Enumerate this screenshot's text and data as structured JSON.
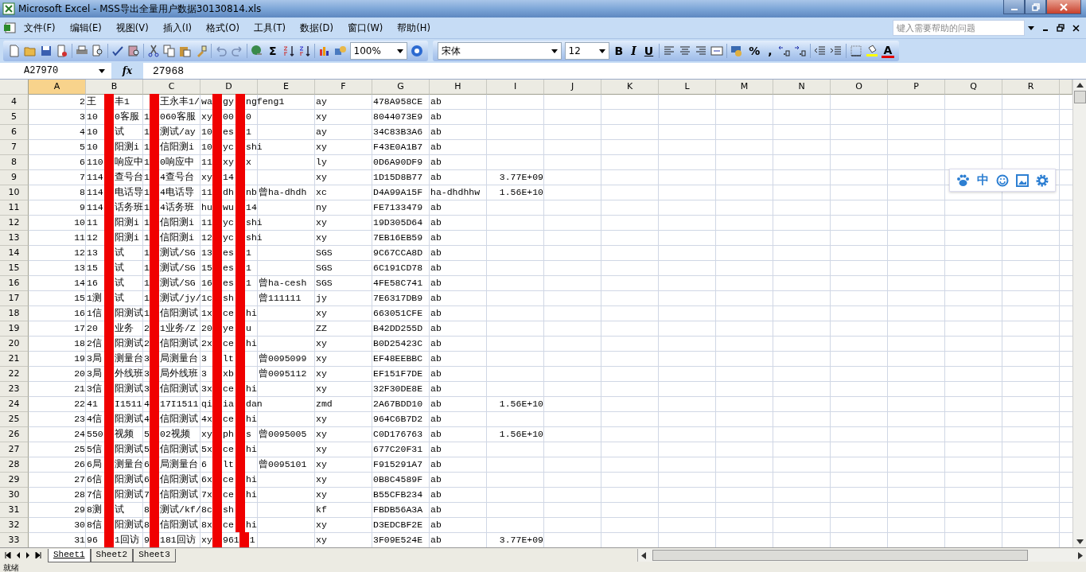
{
  "window": {
    "title": "Microsoft Excel - MSS导出全量用户数据30130814.xls"
  },
  "menu": [
    "文件(F)",
    "编辑(E)",
    "视图(V)",
    "插入(I)",
    "格式(O)",
    "工具(T)",
    "数据(D)",
    "窗口(W)",
    "帮助(H)"
  ],
  "help_search": {
    "placeholder": "键入需要帮助的问题"
  },
  "toolbar": {
    "sum": "Σ",
    "zoom": "100%",
    "font": "宋体",
    "size": "12",
    "format_buttons": [
      "B",
      "I",
      "U"
    ],
    "percent": "%",
    "comma": ",",
    "font_color": "A"
  },
  "formula_bar": {
    "name_box": "A27970",
    "fx": "fx",
    "value": "27968"
  },
  "columns": [
    {
      "label": "A",
      "selected": true
    },
    {
      "label": "B",
      "selected": false
    },
    {
      "label": "C",
      "selected": false
    },
    {
      "label": "D",
      "selected": false
    },
    {
      "label": "E",
      "selected": false
    },
    {
      "label": "F",
      "selected": false
    },
    {
      "label": "G",
      "selected": false
    },
    {
      "label": "H",
      "selected": false
    },
    {
      "label": "I",
      "selected": false
    },
    {
      "label": "J",
      "selected": false
    },
    {
      "label": "K",
      "selected": false
    },
    {
      "label": "L",
      "selected": false
    },
    {
      "label": "M",
      "selected": false
    },
    {
      "label": "N",
      "selected": false
    },
    {
      "label": "O",
      "selected": false
    },
    {
      "label": "P",
      "selected": false
    },
    {
      "label": "Q",
      "selected": false
    },
    {
      "label": "R",
      "selected": false
    }
  ],
  "rows": [
    {
      "num": "4",
      "a": "2",
      "b": {
        "pre": "王",
        "post": "丰1"
      },
      "c": {
        "post": "王永丰1/"
      },
      "d": {
        "pre": "wa",
        "mid": "gy",
        "post": "ngfeng1"
      },
      "f": "ay",
      "g": "478A958CE",
      "h": "ab"
    },
    {
      "num": "5",
      "a": "3",
      "b": {
        "pre": "10",
        "post": "0客服"
      },
      "c": {
        "pre": "1",
        "post": "060客服"
      },
      "d": {
        "pre": "xy",
        "mid": "00",
        "post": "0"
      },
      "f": "xy",
      "g": "8044073E9",
      "h": "ab"
    },
    {
      "num": "6",
      "a": "4",
      "b": {
        "pre": "10",
        "post": "试"
      },
      "c": {
        "pre": "1",
        "post": "测试/ay"
      },
      "d": {
        "pre": "10",
        "mid": "es",
        "post": "1"
      },
      "f": "ay",
      "g": "34C83B3A6",
      "h": "ab"
    },
    {
      "num": "7",
      "a": "5",
      "b": {
        "pre": "10",
        "post": "阳测i"
      },
      "c": {
        "pre": "1",
        "post": "信阳测i"
      },
      "d": {
        "pre": "10",
        "mid": "yc",
        "post": "shi"
      },
      "f": "xy",
      "g": "F43E0A1B7",
      "h": "ab"
    },
    {
      "num": "8",
      "a": "6",
      "b": {
        "pre": "110",
        "post": "响应中"
      },
      "c": {
        "pre": "1",
        "post": "0响应中"
      },
      "d": {
        "pre": "11",
        "mid": "xy",
        "post": "x"
      },
      "f": "ly",
      "g": "0D6A90DF9",
      "h": "ab"
    },
    {
      "num": "9",
      "a": "7",
      "b": {
        "pre": "114",
        "post": "查号台"
      },
      "c": {
        "pre": "1",
        "post": "4查号台"
      },
      "d": {
        "pre": "xy",
        "mid": "14"
      },
      "f": "xy",
      "g": "1D15D8B77",
      "h": "ab",
      "i": "3.77E+09"
    },
    {
      "num": "10",
      "a": "8",
      "b": {
        "pre": "114",
        "post": "电话导"
      },
      "c": {
        "pre": "1",
        "post": "4电话导"
      },
      "d": {
        "pre": "11",
        "mid": "dh",
        "post": "nb"
      },
      "e": "曾ha-dhdh",
      "f": "xc",
      "g": "D4A99A15F",
      "h": "ha-dhdhhw",
      "i": "1.56E+10"
    },
    {
      "num": "11",
      "a": "9",
      "b": {
        "pre": "114",
        "post": "话务班"
      },
      "c": {
        "pre": "1",
        "post": "4话务班"
      },
      "d": {
        "pre": "hu",
        "mid": "wu",
        "post": "14"
      },
      "f": "ny",
      "g": "FE7133479",
      "h": "ab"
    },
    {
      "num": "12",
      "a": "10",
      "b": {
        "pre": "11",
        "post": "阳测i"
      },
      "c": {
        "pre": "1",
        "post": "信阳测i"
      },
      "d": {
        "pre": "11",
        "mid": "yc",
        "post": "shi"
      },
      "f": "xy",
      "g": "19D305D64",
      "h": "ab"
    },
    {
      "num": "13",
      "a": "11",
      "b": {
        "pre": "12",
        "post": "阳测i"
      },
      "c": {
        "pre": "1",
        "post": "信阳测i"
      },
      "d": {
        "pre": "12",
        "mid": "yc",
        "post": "shi"
      },
      "f": "xy",
      "g": "7EB16EB59",
      "h": "ab"
    },
    {
      "num": "14",
      "a": "12",
      "b": {
        "pre": "13",
        "post": "试"
      },
      "c": {
        "pre": "1",
        "post": "测试/SG"
      },
      "d": {
        "pre": "13",
        "mid": "es",
        "post": "1"
      },
      "f": "SGS",
      "g": "9C67CCA8D",
      "h": "ab"
    },
    {
      "num": "15",
      "a": "13",
      "b": {
        "pre": "15",
        "post": "试"
      },
      "c": {
        "pre": "1",
        "post": "测试/SG"
      },
      "d": {
        "pre": "15",
        "mid": "es",
        "post": "1"
      },
      "f": "SGS",
      "g": "6C191CD78",
      "h": "ab"
    },
    {
      "num": "16",
      "a": "14",
      "b": {
        "pre": "16",
        "post": "试"
      },
      "c": {
        "pre": "1",
        "post": "测试/SG"
      },
      "d": {
        "pre": "16",
        "mid": "es",
        "post": "1"
      },
      "e": "曾ha-cesh",
      "f": "SGS",
      "g": "4FE58C741",
      "h": "ab"
    },
    {
      "num": "17",
      "a": "15",
      "b": {
        "pre": "1测",
        "post": "试"
      },
      "c": {
        "pre": "1",
        "post": "测试/jy/"
      },
      "d": {
        "pre": "1c",
        "mid": "sh"
      },
      "e": "曾111111",
      "f": "jy",
      "g": "7E6317DB9",
      "h": "ab"
    },
    {
      "num": "18",
      "a": "16",
      "b": {
        "pre": "1信",
        "post": "阳测试"
      },
      "c": {
        "pre": "1",
        "post": "信阳测试"
      },
      "d": {
        "pre": "1x",
        "mid": "ce",
        "post": "hi"
      },
      "f": "xy",
      "g": "663051CFE",
      "h": "ab"
    },
    {
      "num": "19",
      "a": "17",
      "b": {
        "pre": "20",
        "post": "业务"
      },
      "c": {
        "pre": "2",
        "post": "1业务/Z"
      },
      "d": {
        "pre": "20",
        "mid": "ye",
        "post": "u"
      },
      "f": "ZZ",
      "g": "B42DD255D",
      "h": "ab"
    },
    {
      "num": "20",
      "a": "18",
      "b": {
        "pre": "2信",
        "post": "阳测试"
      },
      "c": {
        "pre": "2",
        "post": "信阳测试"
      },
      "d": {
        "pre": "2x",
        "mid": "ce",
        "post": "hi"
      },
      "f": "xy",
      "g": "B0D25423C",
      "h": "ab"
    },
    {
      "num": "21",
      "a": "19",
      "b": {
        "pre": "3局",
        "post": "测量台"
      },
      "c": {
        "pre": "3",
        "post": "局测量台"
      },
      "d": {
        "pre": "3",
        "mid": "lt"
      },
      "e": "曾0095099",
      "f": "xy",
      "g": "EF48EEBBC",
      "h": "ab"
    },
    {
      "num": "22",
      "a": "20",
      "b": {
        "pre": "3局",
        "post": "外线班"
      },
      "c": {
        "pre": "3",
        "post": "局外线班"
      },
      "d": {
        "pre": "3",
        "mid": "xb"
      },
      "e": "曾0095112",
      "f": "xy",
      "g": "EF151F7DE",
      "h": "ab"
    },
    {
      "num": "23",
      "a": "21",
      "b": {
        "pre": "3信",
        "post": "阳测试"
      },
      "c": {
        "pre": "3",
        "post": "信阳测试"
      },
      "d": {
        "pre": "3x",
        "mid": "ce",
        "post": "hi"
      },
      "f": "xy",
      "g": "32F30DE8E",
      "h": "ab"
    },
    {
      "num": "24",
      "a": "22",
      "b": {
        "pre": "41",
        "post": "I1511"
      },
      "c": {
        "pre": "4",
        "post": "17I1511"
      },
      "d": {
        "pre": "qi",
        "mid": "ia",
        "post": "dan"
      },
      "f": "zmd",
      "g": "2A67BDD10",
      "h": "ab",
      "i": "1.56E+10"
    },
    {
      "num": "25",
      "a": "23",
      "b": {
        "pre": "4信",
        "post": "阳测试"
      },
      "c": {
        "pre": "4",
        "post": "信阳测试"
      },
      "d": {
        "pre": "4x",
        "mid": "ce",
        "post": "hi"
      },
      "f": "xy",
      "g": "964C6B7D2",
      "h": "ab"
    },
    {
      "num": "26",
      "a": "24",
      "b": {
        "pre": "550",
        "post": "视频"
      },
      "c": {
        "pre": "5",
        "post": "02视频"
      },
      "d": {
        "pre": "xy",
        "mid": "ph",
        "post": "s"
      },
      "e": "曾0095005",
      "f": "xy",
      "g": "C0D176763",
      "h": "ab",
      "i": "1.56E+10"
    },
    {
      "num": "27",
      "a": "25",
      "b": {
        "pre": "5信",
        "post": "阳测试"
      },
      "c": {
        "pre": "5",
        "post": "信阳测试"
      },
      "d": {
        "pre": "5x",
        "mid": "ce",
        "post": "hi"
      },
      "f": "xy",
      "g": "677C20F31",
      "h": "ab"
    },
    {
      "num": "28",
      "a": "26",
      "b": {
        "pre": "6局",
        "post": "测量台"
      },
      "c": {
        "pre": "6",
        "post": "局测量台"
      },
      "d": {
        "pre": "6",
        "mid": "lt"
      },
      "e": "曾0095101",
      "f": "xy",
      "g": "F915291A7",
      "h": "ab"
    },
    {
      "num": "29",
      "a": "27",
      "b": {
        "pre": "6信",
        "post": "阳测试"
      },
      "c": {
        "pre": "6",
        "post": "信阳测试"
      },
      "d": {
        "pre": "6x",
        "mid": "ce",
        "post": "hi"
      },
      "f": "xy",
      "g": "0B8C4589F",
      "h": "ab"
    },
    {
      "num": "30",
      "a": "28",
      "b": {
        "pre": "7信",
        "post": "阳测试"
      },
      "c": {
        "pre": "7",
        "post": "信阳测试"
      },
      "d": {
        "pre": "7x",
        "mid": "ce",
        "post": "hi"
      },
      "f": "xy",
      "g": "B55CFB234",
      "h": "ab"
    },
    {
      "num": "31",
      "a": "29",
      "b": {
        "pre": "8测",
        "post": "试"
      },
      "c": {
        "pre": "8",
        "post": "测试/kf/"
      },
      "d": {
        "pre": "8c",
        "mid": "sh"
      },
      "f": "kf",
      "g": "FBDB56A3A",
      "h": "ab"
    },
    {
      "num": "32",
      "a": "30",
      "b": {
        "pre": "8信",
        "post": "阳测试"
      },
      "c": {
        "pre": "8",
        "post": "信阳测试"
      },
      "d": {
        "pre": "8x",
        "mid": "ce",
        "post": "hi"
      },
      "f": "xy",
      "g": "D3EDCBF2E",
      "h": "ab"
    },
    {
      "num": "33",
      "a": "31",
      "b": {
        "pre": "96",
        "post": "1回访"
      },
      "c": {
        "pre": "9",
        "post": "181回访"
      },
      "d": {
        "pre": "xy",
        "mid": "961",
        "post": "1"
      },
      "f": "xy",
      "g": "3F09E524E",
      "h": "ab",
      "i": "3.77E+09"
    }
  ],
  "ime_bar": {
    "lang": "中"
  },
  "sheets": [
    {
      "label": "Sheet1",
      "selected": true
    },
    {
      "label": "Sheet2",
      "selected": false
    },
    {
      "label": "Sheet3",
      "selected": false
    }
  ],
  "status_bar": {
    "text": "就绪"
  }
}
